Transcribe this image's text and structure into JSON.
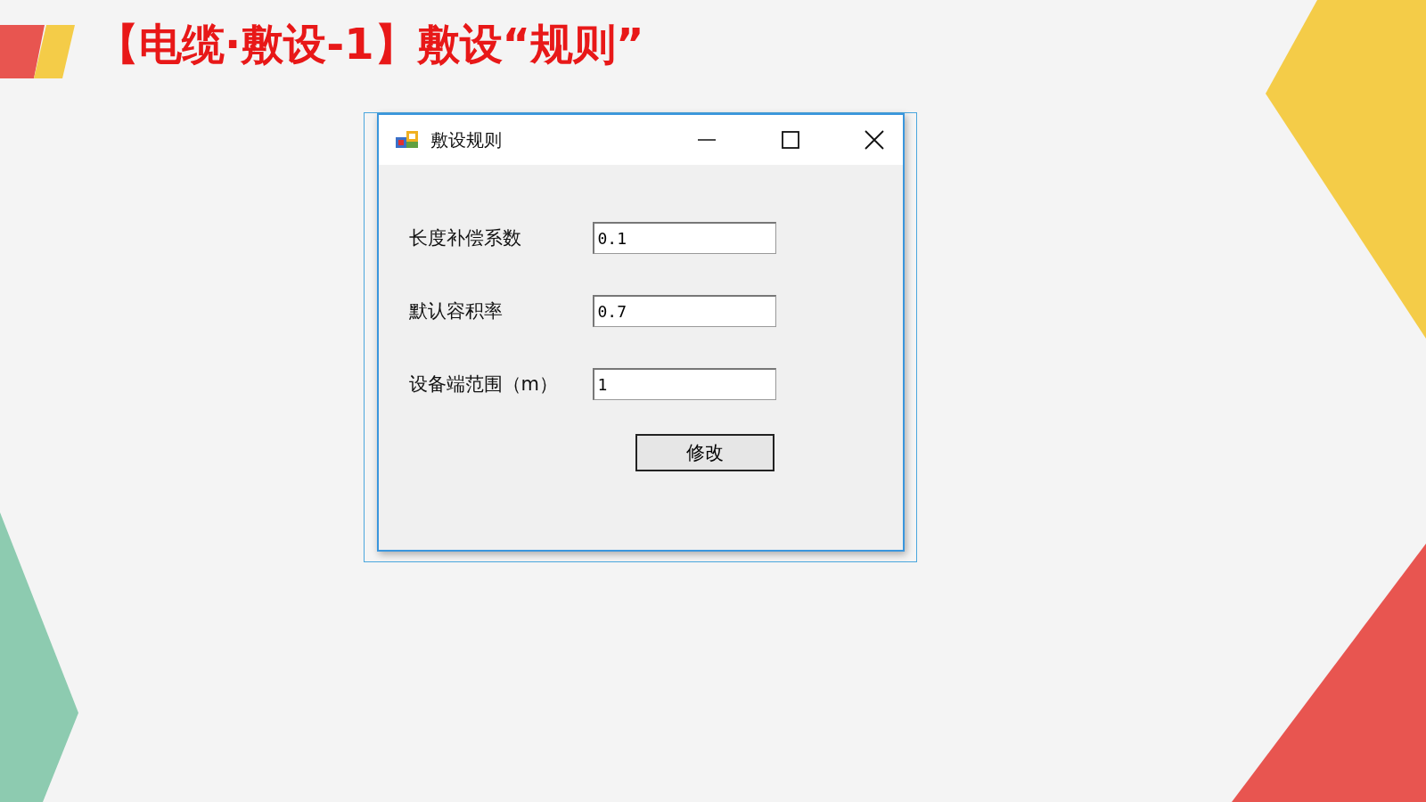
{
  "slide_title": "【电缆·敷设-1】敷设“规则”",
  "dialog": {
    "title": "敷设规则",
    "fields": [
      {
        "label": "长度补偿系数",
        "value": "0.1"
      },
      {
        "label": "默认容积率",
        "value": "0.7"
      },
      {
        "label": "设备端范围（m）",
        "value": "1"
      }
    ],
    "button": "修改"
  }
}
